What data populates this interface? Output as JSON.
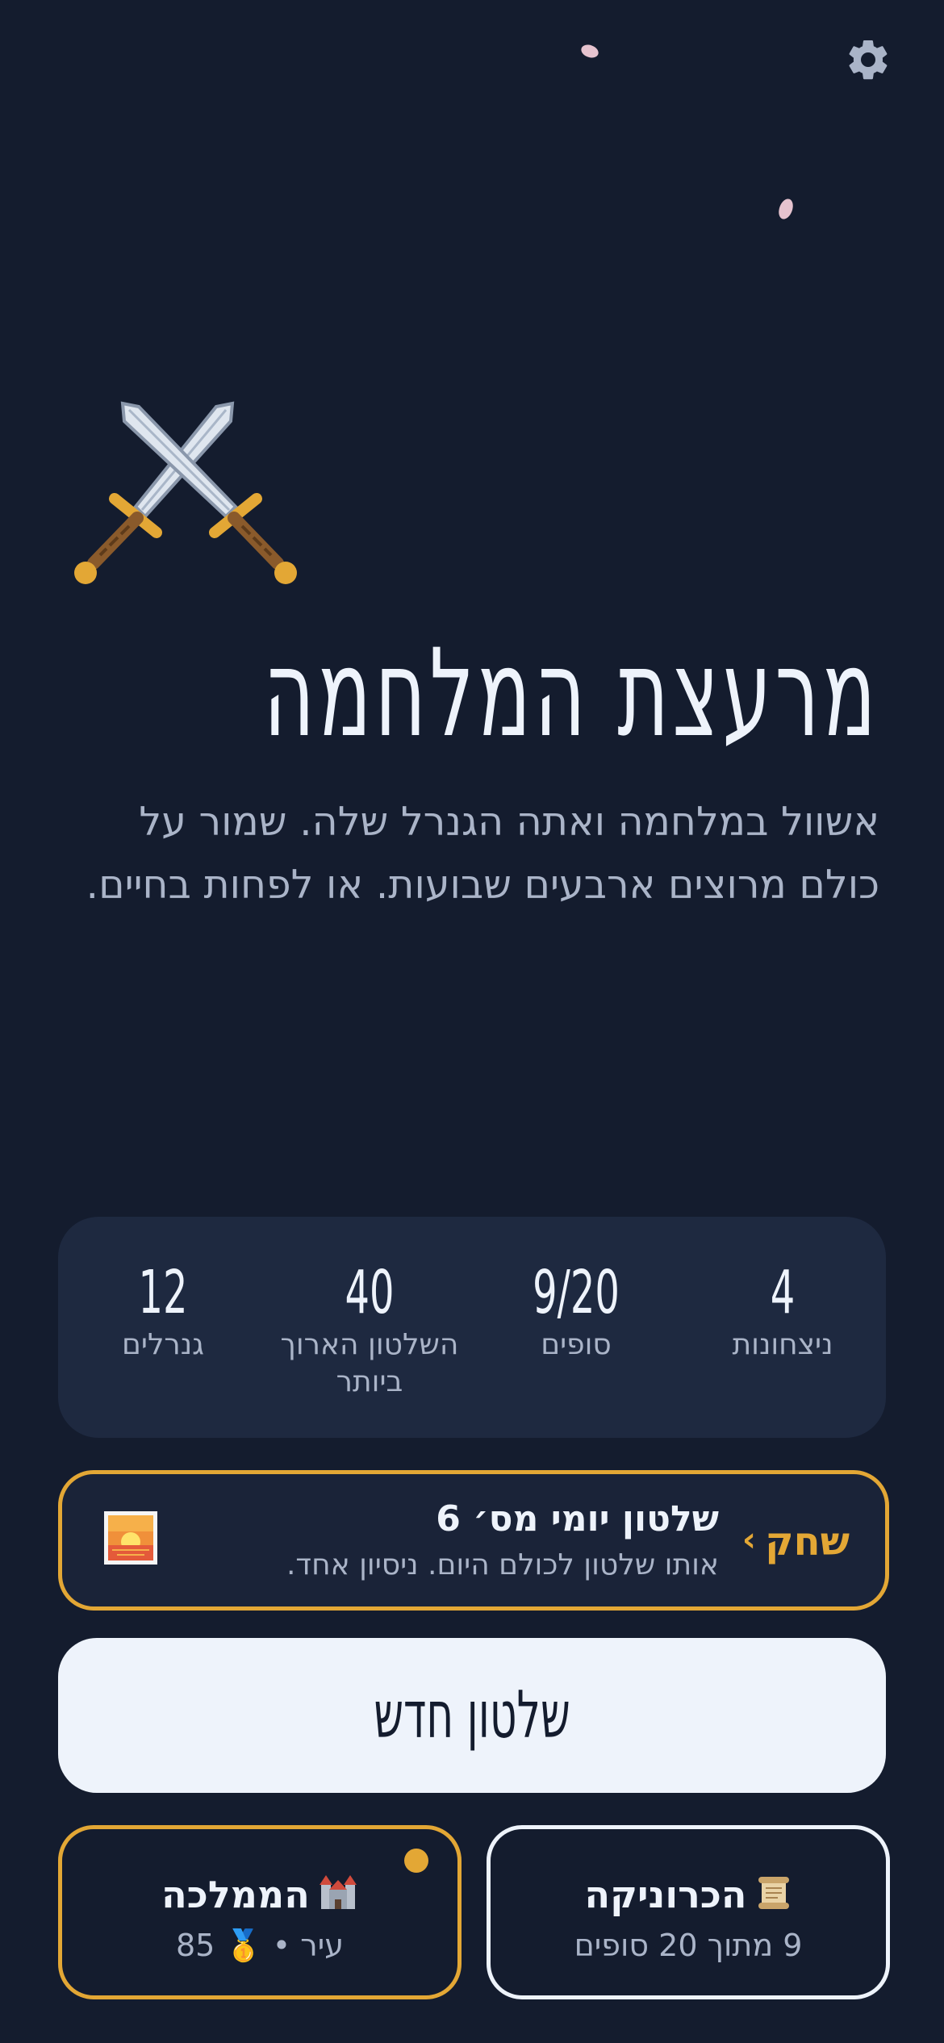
{
  "settings": {
    "icon": "gear-icon"
  },
  "hero": {
    "icon": "crossed-swords-icon",
    "title": "מרעצת המלחמה",
    "subtitle": "אשוול במלחמה ואתה הגנרל שלה. שמור על כולם מרוצים ארבעים שבועות. או לפחות בחיים."
  },
  "stats": [
    {
      "value": "4",
      "label": "ניצחונות"
    },
    {
      "value": "9/20",
      "label": "סופים"
    },
    {
      "value": "40",
      "label": "השלטון הארוך ביותר"
    },
    {
      "value": "12",
      "label": "גנרלים"
    }
  ],
  "daily": {
    "cta": "שחק",
    "chevron": "‹",
    "title": "שלטון יומי מס׳ 6",
    "subtitle": "אותו שלטון לכולם היום. ניסיון אחד.",
    "icon": "sunrise-icon",
    "accent": "#e3a735"
  },
  "new_reign": {
    "label": "שלטון חדש"
  },
  "chronicle": {
    "title": "הכרוניקה",
    "subtitle": "9 מתוך 20 סופים",
    "icon": "scroll-icon"
  },
  "kingdom": {
    "title": "הממלכה",
    "subtitle": "עיר • 🥇 85",
    "icon": "castle-icon"
  },
  "colors": {
    "background": "#141c2e",
    "panel": "#1e2940",
    "accent": "#e3a735",
    "text": "#eef3fb",
    "muted": "#aab4c8"
  }
}
